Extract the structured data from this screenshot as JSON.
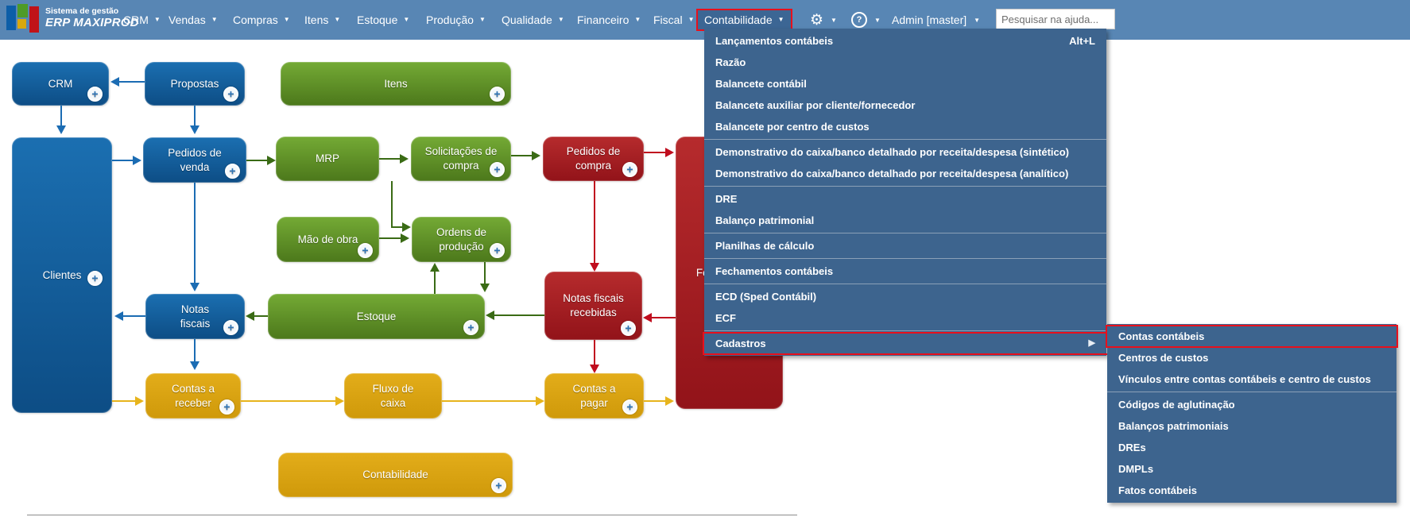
{
  "navbar": {
    "logo": {
      "tagline": "Sistema de gestão",
      "brand": "ERP MAXIPROD"
    },
    "items": [
      {
        "label": "CRM"
      },
      {
        "label": "Vendas"
      },
      {
        "label": "Compras"
      },
      {
        "label": "Itens"
      },
      {
        "label": "Estoque"
      },
      {
        "label": "Produção"
      },
      {
        "label": "Qualidade"
      },
      {
        "label": "Financeiro"
      },
      {
        "label": "Fiscal"
      },
      {
        "label": "Contabilidade",
        "active": true
      }
    ],
    "user_label": "Admin [master]",
    "search_placeholder": "Pesquisar na ajuda..."
  },
  "menu": {
    "items": [
      {
        "label": "Lançamentos contábeis",
        "shortcut": "Alt+L"
      },
      {
        "label": "Razão"
      },
      {
        "label": "Balancete contábil"
      },
      {
        "label": "Balancete auxiliar por cliente/fornecedor"
      },
      {
        "label": "Balancete por centro de custos",
        "sep_after": true
      },
      {
        "label": "Demonstrativo do caixa/banco detalhado por receita/despesa (sintético)"
      },
      {
        "label": "Demonstrativo do caixa/banco detalhado por receita/despesa (analítico)",
        "sep_after": true
      },
      {
        "label": "DRE"
      },
      {
        "label": "Balanço patrimonial",
        "sep_after": true
      },
      {
        "label": "Planilhas de cálculo",
        "sep_after": true
      },
      {
        "label": "Fechamentos contábeis",
        "sep_after": true
      },
      {
        "label": "ECD (Sped Contábil)"
      },
      {
        "label": "ECF",
        "sep_after": true
      },
      {
        "label": "Cadastros",
        "highlighted": true,
        "has_submenu": true
      }
    ]
  },
  "submenu": {
    "items": [
      {
        "label": "Contas contábeis",
        "highlighted": true
      },
      {
        "label": "Centros de custos"
      },
      {
        "label": "Vínculos entre contas contábeis e centro de custos",
        "sep_after": true
      },
      {
        "label": "Códigos de aglutinação"
      },
      {
        "label": "Balanços patrimoniais"
      },
      {
        "label": "DREs"
      },
      {
        "label": "DMPLs"
      },
      {
        "label": "Fatos contábeis"
      }
    ]
  },
  "flowchart": {
    "nodes": [
      {
        "id": "crm",
        "label": "CRM",
        "color": "blue",
        "add": true
      },
      {
        "id": "propostas",
        "label": "Propostas",
        "color": "blue",
        "add": true
      },
      {
        "id": "itens",
        "label": "Itens",
        "color": "green",
        "add": true
      },
      {
        "id": "clientes",
        "label": "Clientes",
        "color": "blue",
        "add": true
      },
      {
        "id": "pedidos-venda",
        "label": "Pedidos de\nvenda",
        "color": "blue",
        "add": true
      },
      {
        "id": "mrp",
        "label": "MRP",
        "color": "green",
        "add": false
      },
      {
        "id": "solicitacoes",
        "label": "Solicitações de\ncompra",
        "color": "green",
        "add": true
      },
      {
        "id": "pedidos-compra",
        "label": "Pedidos de\ncompra",
        "color": "red",
        "add": true
      },
      {
        "id": "fornecedores",
        "label": "Fornecedores",
        "color": "red",
        "add": false
      },
      {
        "id": "mao-obra",
        "label": "Mão de obra",
        "color": "green",
        "add": true
      },
      {
        "id": "ordens",
        "label": "Ordens de\nprodução",
        "color": "green",
        "add": true
      },
      {
        "id": "notas-fiscais",
        "label": "Notas\nfiscais",
        "color": "blue",
        "add": true
      },
      {
        "id": "estoque",
        "label": "Estoque",
        "color": "green",
        "add": true
      },
      {
        "id": "nf-recebidas",
        "label": "Notas fiscais\nrecebidas",
        "color": "red",
        "add": true
      },
      {
        "id": "contas-receber",
        "label": "Contas a\nreceber",
        "color": "yellow",
        "add": true
      },
      {
        "id": "fluxo-caixa",
        "label": "Fluxo de\ncaixa",
        "color": "yellow",
        "add": false
      },
      {
        "id": "contas-pagar",
        "label": "Contas a\npagar",
        "color": "yellow",
        "add": true
      },
      {
        "id": "contabilidade",
        "label": "Contabilidade",
        "color": "yellow",
        "add": true
      }
    ]
  },
  "colors": {
    "navbar_bg": "#5886b4",
    "menu_bg": "#3d648e",
    "highlight_red": "#e8101c",
    "node_blue": "#0d4d85",
    "node_green": "#4c781b",
    "node_red": "#921319",
    "node_yellow": "#cf990a",
    "arrow_blue": "#1b6cb3",
    "arrow_green": "#3a6b15",
    "arrow_red": "#c00d1e",
    "arrow_yellow": "#e7b41c"
  }
}
